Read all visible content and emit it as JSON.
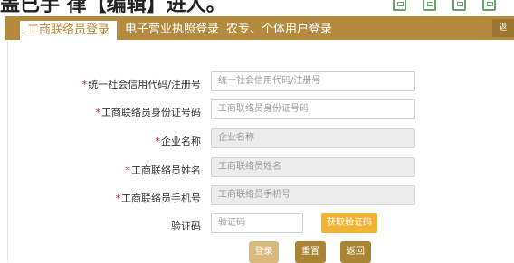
{
  "header": {
    "heading_partial": "盖已手 律【编辑】进人。"
  },
  "toolbar": {
    "icons": [
      "edit-icon",
      "expand-icon",
      "home-icon",
      "save-icon"
    ]
  },
  "tabs": [
    {
      "label": "工商联络员登录",
      "active": true
    },
    {
      "label": "电子营业执照登录",
      "active": false
    },
    {
      "label": "农专、个体用户登录",
      "active": false
    }
  ],
  "corner_button": "返",
  "form": {
    "credit_code": {
      "label": "统一社会信用代码/注册号",
      "required": true,
      "placeholder": "统一社会信用代码/注册号"
    },
    "id_number": {
      "label": "工商联络员身份证号码",
      "required": true,
      "placeholder": "工商联络员身份证号码"
    },
    "company_name": {
      "label": "企业名称",
      "required": true,
      "placeholder": "企业名称"
    },
    "liaison_name": {
      "label": "工商联络员姓名",
      "required": true,
      "placeholder": "工商联络员姓名"
    },
    "liaison_phone": {
      "label": "工商联络员手机号",
      "required": true,
      "placeholder": "工商联络员手机号"
    },
    "captcha": {
      "label": "验证码",
      "required": false,
      "placeholder": "验证码",
      "send_button": "获取验证码"
    }
  },
  "actions": {
    "login": "登录",
    "reset": "重置",
    "back": "返回"
  },
  "colors": {
    "brand": "#b48b3e",
    "brand_dark": "#9b7531",
    "accent": "#f2b233",
    "login_button": "#d9ba7c",
    "required_star": "#b22222"
  }
}
